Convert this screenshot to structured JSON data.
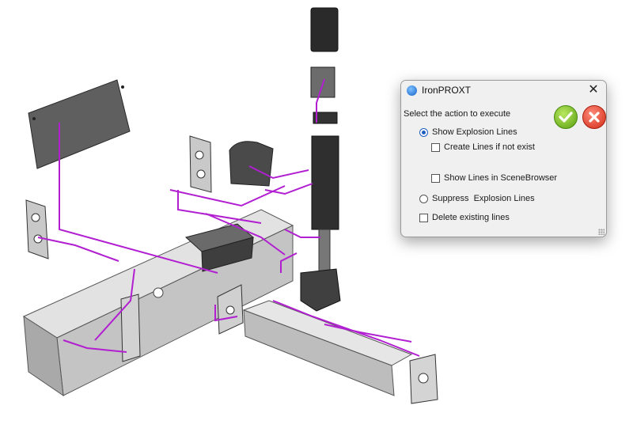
{
  "dialog": {
    "title": "IronPROXT",
    "prompt": "Select the action to execute",
    "options": {
      "show": {
        "label": "Show Explosion Lines",
        "selected": true
      },
      "create_if_not_exist": {
        "label": "Create Lines if not exist",
        "checked": false
      },
      "show_in_scenebrowser": {
        "label": "Show Lines in SceneBrowser",
        "checked": false
      },
      "suppress": {
        "label": "Suppress  Explosion Lines",
        "selected": false
      },
      "delete_existing": {
        "label": "Delete existing lines",
        "checked": false
      }
    },
    "buttons": {
      "ok_icon": "green-check-icon",
      "cancel_icon": "red-x-icon"
    },
    "close_icon": "close-icon"
  },
  "scene": {
    "explosion_line_color": "#b11fd1",
    "part_color": "#b8b8b8"
  }
}
